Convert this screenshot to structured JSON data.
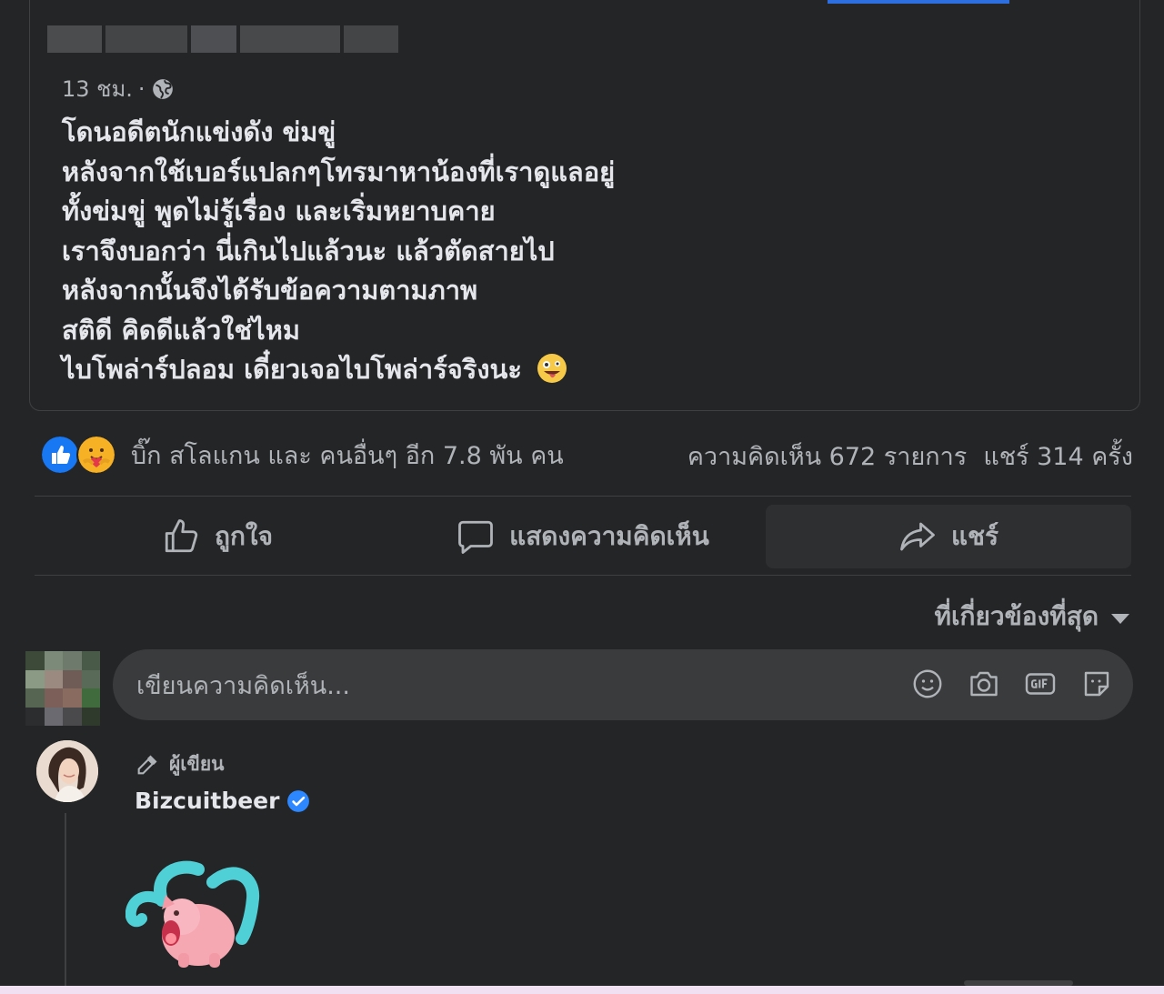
{
  "post": {
    "time": "13 ชม.",
    "separator": "·",
    "lines": [
      "โดนอดีตนักแข่งดัง ข่มขู่",
      "หลังจากใช้เบอร์แปลกๆโทรมาหาน้องที่เราดูแลอยู่",
      "ทั้งข่มขู่ พูดไม่รู้เรื่อง และเริ่มหยาบคาย",
      "เราจึงบอกว่า นี่เกินไปแล้วนะ แล้วตัดสายไป",
      "หลังจากนั้นจึงได้รับข้อความตามภาพ",
      "สติดี คิดดีแล้วใช่ไหม",
      "ไบโพล่าร์ปลอม เดี๋ยวเจอไบโพล่าร์จริงนะ"
    ]
  },
  "reactions": {
    "summary": "บิ๊ก สโลแกน และ คนอื่นๆ อีก 7.8 พัน คน",
    "comments": "ความคิดเห็น 672 รายการ",
    "shares": "แชร์ 314 ครั้ง",
    "like_color": "#1877f2"
  },
  "actions": {
    "like": "ถูกใจ",
    "comment": "แสดงความคิดเห็น",
    "share": "แชร์"
  },
  "sort": {
    "label": "ที่เกี่ยวข้องที่สุด"
  },
  "composer": {
    "placeholder": "เขียนความคิดเห็น..."
  },
  "comment": {
    "badge": "ผู้เขียน",
    "author": "Bizcuitbeer",
    "verified_color": "#2d88ff"
  }
}
